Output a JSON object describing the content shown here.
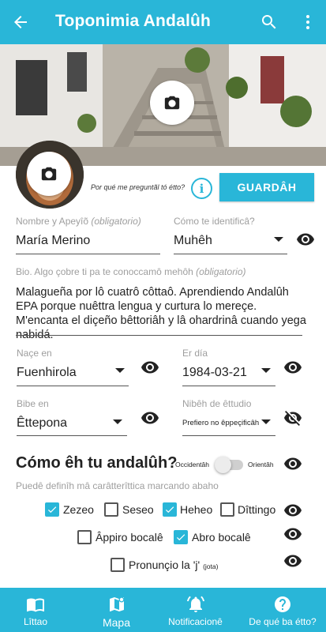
{
  "appbar": {
    "title": "Toponimia Andalûh",
    "back_icon": "arrow-back-icon",
    "search_icon": "search-icon",
    "more_icon": "more-vert-icon"
  },
  "profile": {
    "why_text": "Por qué me preguntãl tó étto?",
    "info_icon_label": "i",
    "save_label": "GUARDÂH"
  },
  "fields": {
    "name": {
      "label": "Nombre y Apeyîõ",
      "required": "(obligatorio)",
      "value": "María Merino"
    },
    "identify": {
      "label": "Cómo te identificâ?",
      "value": "Muhêh"
    },
    "bio": {
      "label": "Bio. Algo çobre ti pa te conoccamô mehôh",
      "required": "(obligatorio)",
      "value": "Malagueña por lô cuatrô côttaô. Aprendiendo Andalûh EPA porque nuêttra lengua y curtura lo mereçe. M'encanta el diçeño bêttoriâh y lâ ohardrinâ cuando yega nabidá."
    },
    "born_in": {
      "label": "Naçe en",
      "value": "Fuenhirola"
    },
    "day": {
      "label": "Er día",
      "value": "1984-03-21"
    },
    "lives_in": {
      "label": "Bibe en",
      "value": "Êttepona"
    },
    "studies": {
      "label": "Nibêh de êttudio",
      "value": "Prefiero no êppeçificâh"
    }
  },
  "andaluh": {
    "title": "Cómo êh tu andalûh?",
    "toggle_left": "Occidentâh",
    "toggle_right": "Orientâh",
    "toggle_on": false,
    "hint": "Puedê definîh mâ carâtterîttica marcando abaho",
    "features": [
      {
        "label": "Zezeo",
        "checked": true
      },
      {
        "label": "Seseo",
        "checked": false
      },
      {
        "label": "Heheo",
        "checked": true
      },
      {
        "label": "Dîttingo",
        "checked": false
      },
      {
        "label": "Âppiro bocalê",
        "checked": false
      },
      {
        "label": "Abro bocalê",
        "checked": true
      },
      {
        "label": "Pronunçio la 'j'",
        "note": "(jota)",
        "checked": false
      }
    ]
  },
  "bottomnav": {
    "items": [
      {
        "label": "Lîttao",
        "icon": "map-book-icon"
      },
      {
        "label": "Mapa",
        "icon": "map-pin-icon",
        "active": true
      },
      {
        "label": "Notificacionê",
        "icon": "bell-ring-icon"
      },
      {
        "label": "De qué ba étto?",
        "icon": "help-circle-icon"
      }
    ]
  },
  "colors": {
    "accent": "#29b6d8"
  }
}
